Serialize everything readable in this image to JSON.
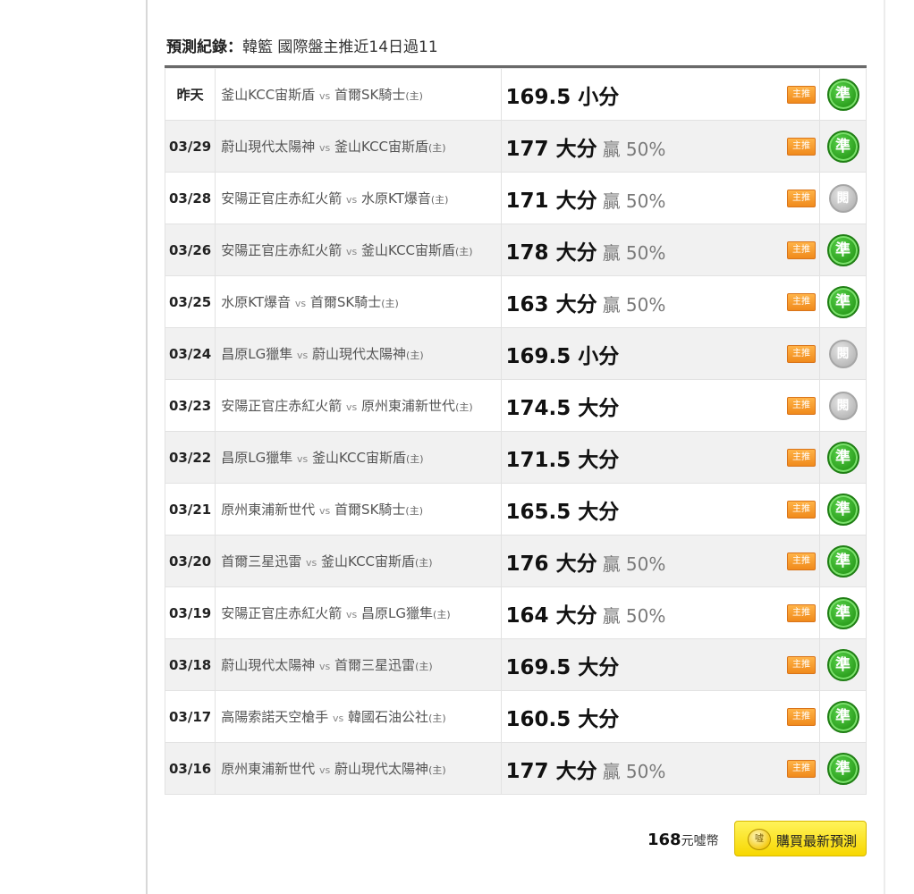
{
  "header": {
    "label": "預測紀錄：",
    "title": "韓籃 國際盤主推近14日過11"
  },
  "vs_text": "vs",
  "tag_label": "主推",
  "records": [
    {
      "date": "昨天",
      "away": "釜山KCC宙斯盾",
      "home": "首爾SK騎士",
      "home_mark": "(主)",
      "line": "169.5 小分",
      "winrate": "",
      "result": "準",
      "status": "hit"
    },
    {
      "date": "03/29",
      "away": "蔚山現代太陽神",
      "home": "釜山KCC宙斯盾",
      "home_mark": "(主)",
      "line": "177 大分",
      "winrate": "贏 50%",
      "result": "準",
      "status": "hit"
    },
    {
      "date": "03/28",
      "away": "安陽正官庄赤紅火箭",
      "home": "水原KT爆音",
      "home_mark": "(主)",
      "line": "171 大分",
      "winrate": "贏 50%",
      "result": "閱",
      "status": "pending"
    },
    {
      "date": "03/26",
      "away": "安陽正官庄赤紅火箭",
      "home": "釜山KCC宙斯盾",
      "home_mark": "(主)",
      "line": "178 大分",
      "winrate": "贏 50%",
      "result": "準",
      "status": "hit"
    },
    {
      "date": "03/25",
      "away": "水原KT爆音",
      "home": "首爾SK騎士",
      "home_mark": "(主)",
      "line": "163 大分",
      "winrate": "贏 50%",
      "result": "準",
      "status": "hit"
    },
    {
      "date": "03/24",
      "away": "昌原LG獵隼",
      "home": "蔚山現代太陽神",
      "home_mark": "(主)",
      "line": "169.5 小分",
      "winrate": "",
      "result": "閱",
      "status": "pending"
    },
    {
      "date": "03/23",
      "away": "安陽正官庄赤紅火箭",
      "home": "原州東浦新世代",
      "home_mark": "(主)",
      "line": "174.5 大分",
      "winrate": "",
      "result": "閱",
      "status": "pending"
    },
    {
      "date": "03/22",
      "away": "昌原LG獵隼",
      "home": "釜山KCC宙斯盾",
      "home_mark": "(主)",
      "line": "171.5 大分",
      "winrate": "",
      "result": "準",
      "status": "hit"
    },
    {
      "date": "03/21",
      "away": "原州東浦新世代",
      "home": "首爾SK騎士",
      "home_mark": "(主)",
      "line": "165.5 大分",
      "winrate": "",
      "result": "準",
      "status": "hit"
    },
    {
      "date": "03/20",
      "away": "首爾三星迅雷",
      "home": "釜山KCC宙斯盾",
      "home_mark": "(主)",
      "line": "176 大分",
      "winrate": "贏 50%",
      "result": "準",
      "status": "hit"
    },
    {
      "date": "03/19",
      "away": "安陽正官庄赤紅火箭",
      "home": "昌原LG獵隼",
      "home_mark": "(主)",
      "line": "164 大分",
      "winrate": "贏 50%",
      "result": "準",
      "status": "hit"
    },
    {
      "date": "03/18",
      "away": "蔚山現代太陽神",
      "home": "首爾三星迅雷",
      "home_mark": "(主)",
      "line": "169.5 大分",
      "winrate": "",
      "result": "準",
      "status": "hit"
    },
    {
      "date": "03/17",
      "away": "高陽索諾天空槍手",
      "home": "韓國石油公社",
      "home_mark": "(主)",
      "line": "160.5 大分",
      "winrate": "",
      "result": "準",
      "status": "hit"
    },
    {
      "date": "03/16",
      "away": "原州東浦新世代",
      "home": "蔚山現代太陽神",
      "home_mark": "(主)",
      "line": "177 大分",
      "winrate": "贏 50%",
      "result": "準",
      "status": "hit"
    }
  ],
  "footer": {
    "price": "168",
    "price_unit": "元噓幣",
    "buy_icon_text": "噓",
    "buy_label": "購買最新預測"
  },
  "colors": {
    "hit": "#2a9d1c",
    "pending": "#b8b8b8",
    "tag": "#f08a1c",
    "buy_button": "#f7d700"
  }
}
